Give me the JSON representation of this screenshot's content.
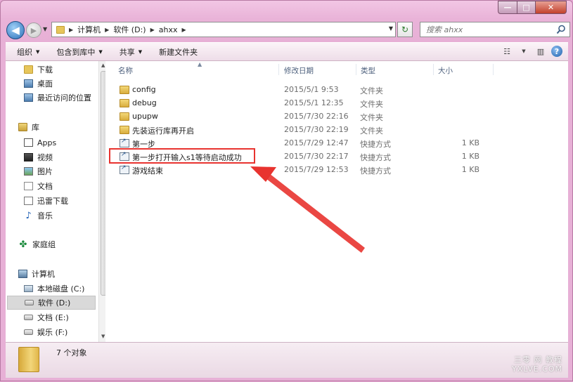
{
  "window": {
    "caption_buttons": {
      "minimize": "—",
      "maximize": "□",
      "close": "✕"
    }
  },
  "nav": {
    "back_glyph": "◀",
    "forward_glyph": "▶",
    "history_glyph": "▼",
    "breadcrumbs": [
      "计算机",
      "软件 (D:)",
      "ahxx"
    ],
    "refresh_glyph": "↻",
    "search_placeholder": "搜索 ahxx"
  },
  "toolbar": {
    "organize": "组织",
    "include_in_library": "包含到库中",
    "share": "共享",
    "new_folder": "新建文件夹"
  },
  "sidebar": {
    "items": [
      {
        "label": "下载",
        "icon": "download-folder-icon"
      },
      {
        "label": "桌面",
        "icon": "desktop-folder-icon"
      },
      {
        "label": "最近访问的位置",
        "icon": "recent-places-icon"
      },
      {
        "label": "库",
        "icon": "libraries-icon"
      },
      {
        "label": "Apps",
        "icon": "apps-library-icon"
      },
      {
        "label": "视频",
        "icon": "videos-library-icon"
      },
      {
        "label": "图片",
        "icon": "pictures-library-icon"
      },
      {
        "label": "文档",
        "icon": "documents-library-icon"
      },
      {
        "label": "迅雷下载",
        "icon": "thunder-download-icon"
      },
      {
        "label": "音乐",
        "icon": "music-library-icon"
      },
      {
        "label": "家庭组",
        "icon": "homegroup-icon"
      },
      {
        "label": "计算机",
        "icon": "computer-icon"
      },
      {
        "label": "本地磁盘 (C:)",
        "icon": "system-drive-icon"
      },
      {
        "label": "软件 (D:)",
        "icon": "drive-icon"
      },
      {
        "label": "文档 (E:)",
        "icon": "drive-icon"
      },
      {
        "label": "娱乐 (F:)",
        "icon": "drive-icon"
      }
    ]
  },
  "columns": {
    "name": "名称",
    "modified": "修改日期",
    "type": "类型",
    "size": "大小"
  },
  "files": [
    {
      "name": "config",
      "modified": "2015/5/1 9:53",
      "type": "文件夹",
      "size": "",
      "kind": "folder"
    },
    {
      "name": "debug",
      "modified": "2015/5/1 12:35",
      "type": "文件夹",
      "size": "",
      "kind": "folder"
    },
    {
      "name": "upupw",
      "modified": "2015/7/30 22:16",
      "type": "文件夹",
      "size": "",
      "kind": "folder"
    },
    {
      "name": "先装运行库再开启",
      "modified": "2015/7/30 22:19",
      "type": "文件夹",
      "size": "",
      "kind": "folder"
    },
    {
      "name": "第一步",
      "modified": "2015/7/29 12:47",
      "type": "快捷方式",
      "size": "1 KB",
      "kind": "shortcut"
    },
    {
      "name": "第一步打开输入s1等待启动成功",
      "modified": "2015/7/30 22:17",
      "type": "快捷方式",
      "size": "1 KB",
      "kind": "shortcut"
    },
    {
      "name": "游戏结束",
      "modified": "2015/7/29 12:53",
      "type": "快捷方式",
      "size": "1 KB",
      "kind": "shortcut"
    }
  ],
  "status": {
    "count": "7 个对象"
  },
  "watermark": {
    "line1": "三零 网 教程",
    "line2": "YXLVE.COM"
  },
  "colors": {
    "annotation": "#e8332f",
    "window_frame": "#e9b3d8"
  }
}
